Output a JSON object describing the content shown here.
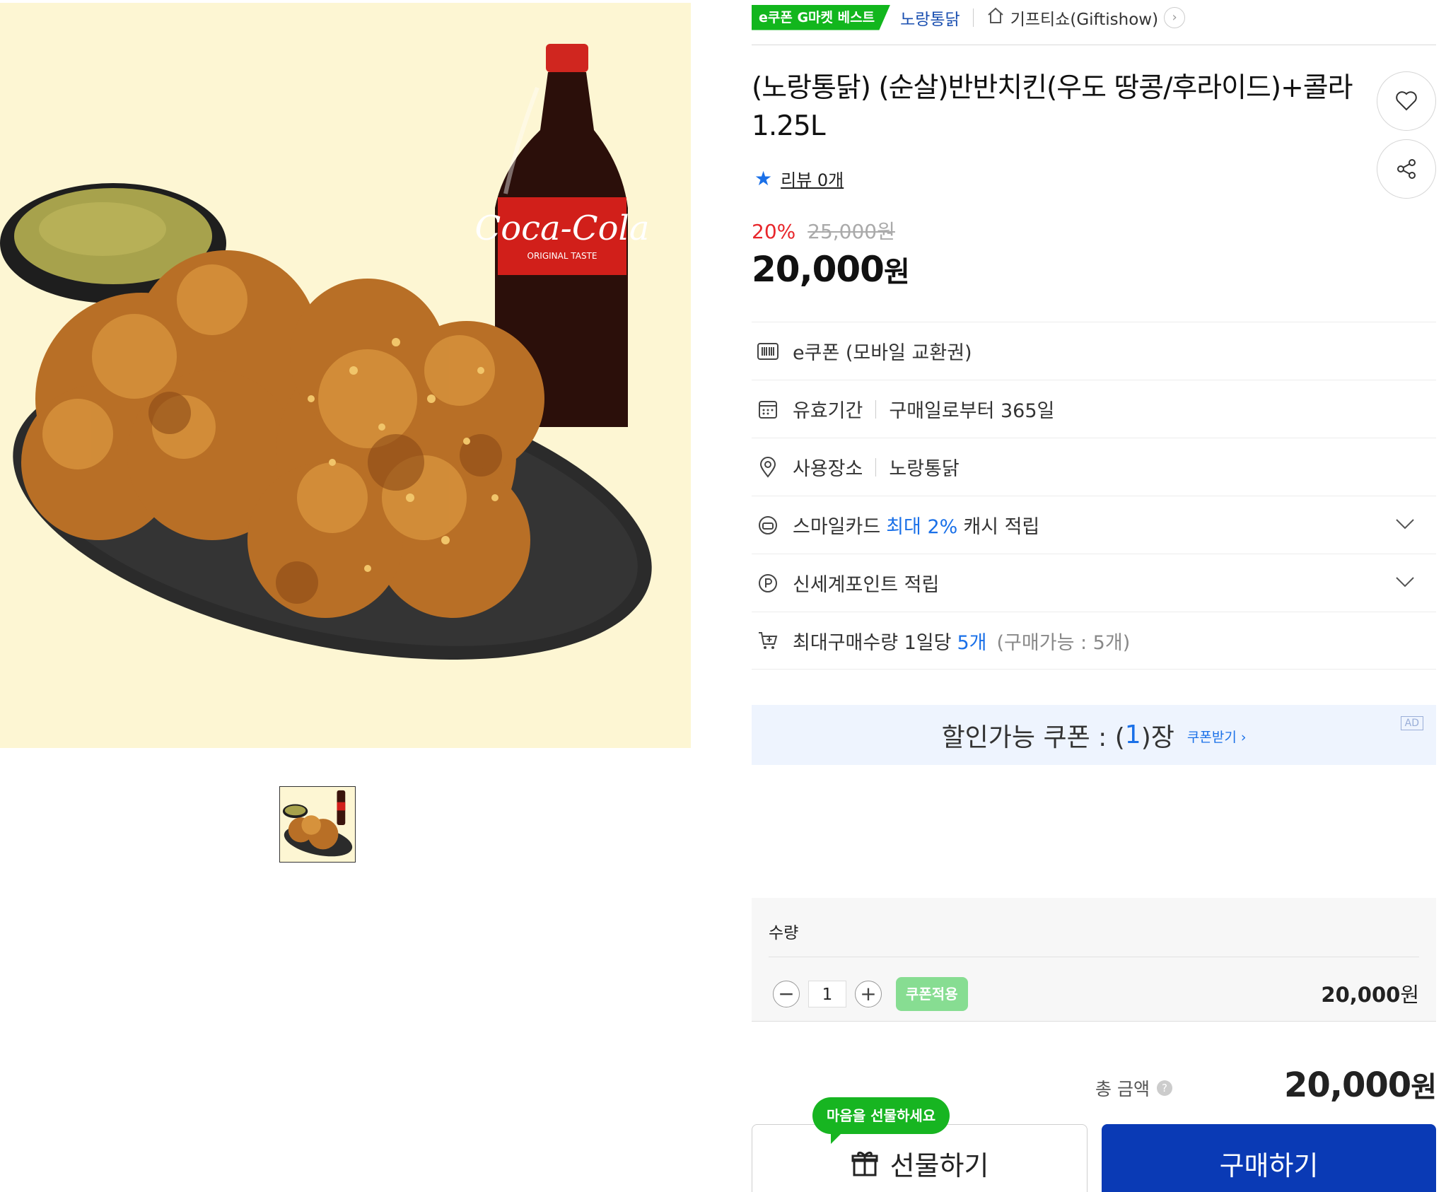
{
  "header": {
    "badge": "e쿠폰 G마켓 베스트",
    "brand": "노랑통닭",
    "shop": "기프티쇼(Giftishow)",
    "shop_chevron": "›"
  },
  "product": {
    "title": "(노랑통닭) (순살)반반치킨(우도 땅콩/후라이드)+콜라 1.25L",
    "review_link": "리뷰 0개",
    "discount_rate": "20%",
    "original_price": "25,000원",
    "price": "20,000",
    "price_unit": "원"
  },
  "info": {
    "type": "e쿠폰 (모바일 교환권)",
    "validity_label": "유효기간",
    "validity_value": "구매일로부터 365일",
    "place_label": "사용장소",
    "place_value": "노랑통닭",
    "smilecard_prefix": "스마일카드",
    "smilecard_highlight": "최대 2%",
    "smilecard_suffix": "캐시 적립",
    "shinsegae": "신세계포인트 적립",
    "maxbuy_prefix": "최대구매수량 1일당",
    "maxbuy_highlight": "5개",
    "maxbuy_note": "(구매가능 : 5개)"
  },
  "coupon": {
    "label_prefix": "할인가능 쿠폰 : (",
    "count": "1",
    "label_suffix": ")장",
    "get_link": "쿠폰받기 ›",
    "ad": "AD"
  },
  "quantity": {
    "label": "수량",
    "minus": "−",
    "value": "1",
    "plus": "+",
    "coupon_apply": "쿠폰적용",
    "line_price": "20,000",
    "unit": "원"
  },
  "total": {
    "label": "총 금액",
    "help": "?",
    "price": "20,000",
    "unit": "원"
  },
  "actions": {
    "tooltip": "마음을 선물하세요",
    "gift": "선물하기",
    "buy": "구매하기"
  },
  "icons": {
    "heart": "heart-icon",
    "share": "share-icon",
    "star": "star-icon",
    "home": "home-icon",
    "barcode": "barcode-icon",
    "calendar": "calendar-icon",
    "location": "location-pin-icon",
    "card": "card-icon",
    "point": "point-icon",
    "cart": "cart-plus-icon",
    "gift": "gift-icon",
    "chevron_down": "chevron-down-icon"
  },
  "colors": {
    "image_bg": "#fdf6d3",
    "badge_green": "#12b61d",
    "accent_blue": "#1a70e8",
    "discount_red": "#e8262b",
    "buy_button": "#0a3ab5",
    "coupon_bg": "#eef4fe"
  }
}
